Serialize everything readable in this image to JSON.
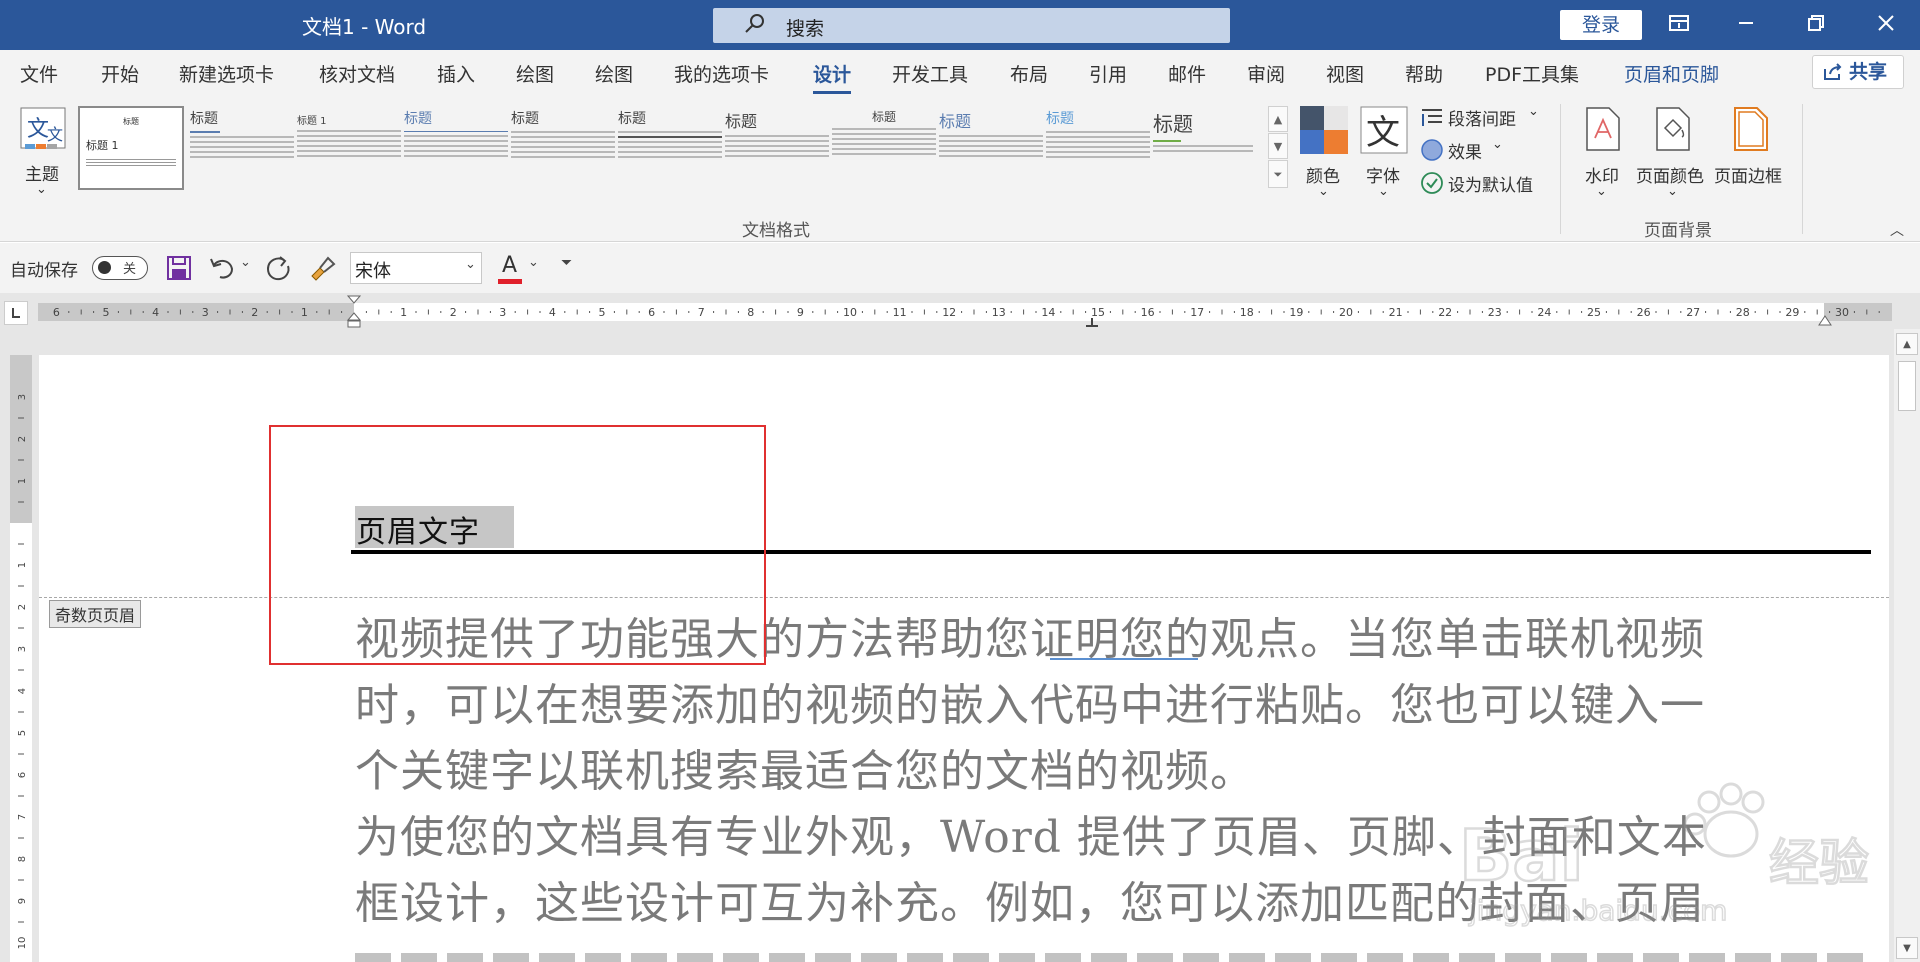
{
  "window": {
    "title": "文档1  -  Word",
    "search_placeholder": "搜索",
    "login_label": "登录"
  },
  "menu": {
    "tabs": [
      "文件",
      "开始",
      "新建选项卡",
      "核对文档",
      "插入",
      "绘图",
      "绘图",
      "我的选项卡",
      "设计",
      "开发工具",
      "布局",
      "引用",
      "邮件",
      "审阅",
      "视图",
      "帮助",
      "PDF工具集",
      "页眉和页脚"
    ],
    "active_tab": "设计",
    "share_label": "共享"
  },
  "ribbon": {
    "theme_label": "主题",
    "gallery_title": "标题",
    "gallery_heading1": "标题 1",
    "doc_format_group": "文档格式",
    "colors_label": "颜色",
    "fonts_label": "字体",
    "paragraph_spacing_label": "段落间距",
    "effects_label": "效果",
    "set_default_label": "设为默认值",
    "watermark_label": "水印",
    "page_color_label": "页面颜色",
    "page_border_label": "页面边框",
    "page_background_group": "页面背景"
  },
  "qat": {
    "autosave_label": "自动保存",
    "autosave_state": "关",
    "font_name": "宋体",
    "font_color_letter": "A"
  },
  "document": {
    "header_text": "页眉文字",
    "header_tag": "奇数页页眉",
    "lines": [
      "视频提供了功能强大的方法帮助您证明您的观点。当您单击联机视频",
      "时，可以在想要添加的视频的嵌入代码中进行粘贴。您也可以键入一",
      "个关键字以联机搜索最适合您的文档的视频。",
      "为使您的文档具有专业外观，Word 提供了页眉、页脚、封面和文本",
      "框设计，这些设计可互为补充。例如，您可以添加匹配的封面、页眉"
    ]
  },
  "colors": {
    "accent": "#2b579a",
    "highlight_box": "#e03030"
  }
}
